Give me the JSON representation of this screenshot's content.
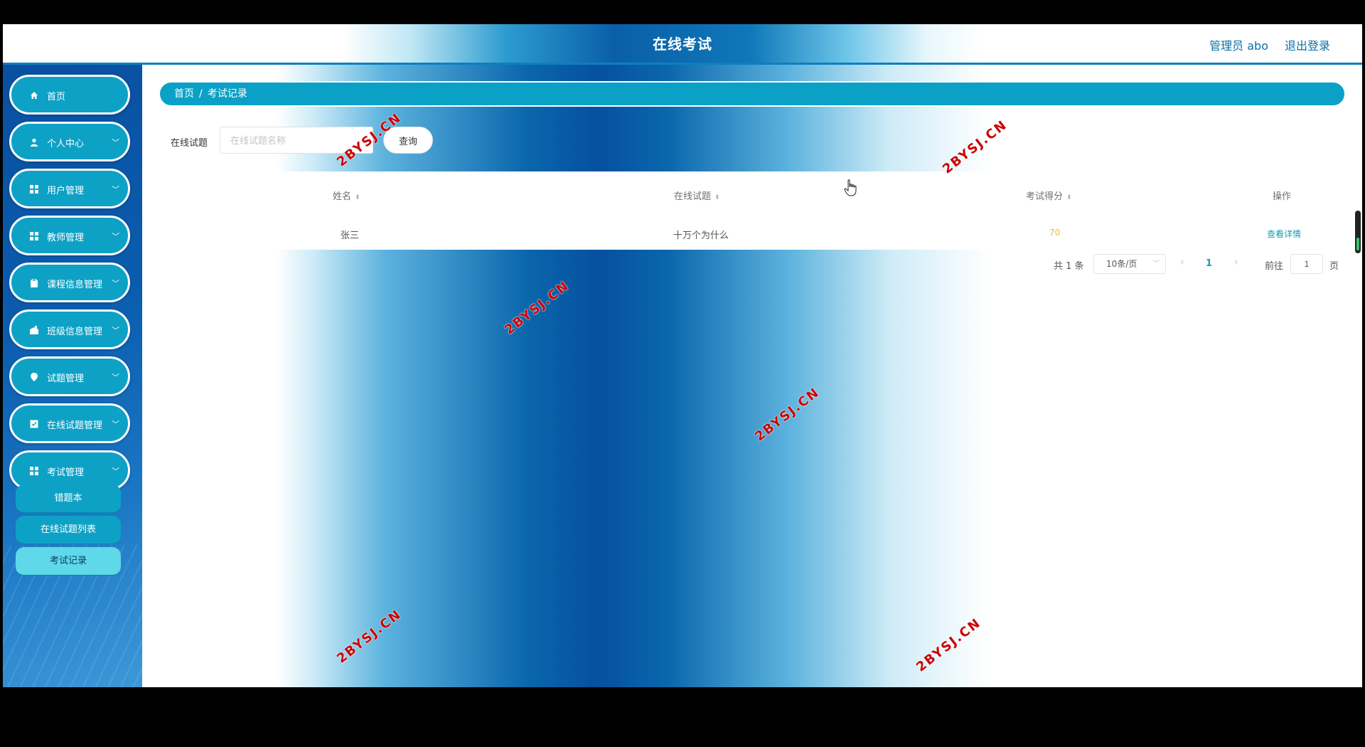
{
  "header": {
    "title": "在线考试",
    "user": "管理员 abo",
    "logout": "退出登录"
  },
  "sidebar": {
    "items": [
      {
        "label": "首页",
        "icon": "home-icon",
        "has_children": false
      },
      {
        "label": "个人中心",
        "icon": "user-icon",
        "has_children": true
      },
      {
        "label": "用户管理",
        "icon": "grid-icon",
        "has_children": true
      },
      {
        "label": "教师管理",
        "icon": "grid-icon",
        "has_children": true
      },
      {
        "label": "课程信息管理",
        "icon": "clipboard-icon",
        "has_children": true
      },
      {
        "label": "班级信息管理",
        "icon": "class-icon",
        "has_children": true
      },
      {
        "label": "试题管理",
        "icon": "pin-icon",
        "has_children": true
      },
      {
        "label": "在线试题管理",
        "icon": "doc-icon",
        "has_children": true
      },
      {
        "label": "考试管理",
        "icon": "grid-icon",
        "has_children": true,
        "expanded": true
      }
    ],
    "submenu": [
      {
        "label": "错题本"
      },
      {
        "label": "在线试题列表"
      },
      {
        "label": "考试记录",
        "active": true
      }
    ]
  },
  "breadcrumb": {
    "home": "首页",
    "current": "考试记录"
  },
  "search": {
    "label": "在线试题",
    "placeholder": "在线试题名称",
    "button": "查询"
  },
  "table": {
    "columns": [
      "姓名",
      "在线试题",
      "考试得分",
      "操作"
    ],
    "rows": [
      {
        "name": "张三",
        "exam": "十万个为什么",
        "score": "70",
        "action": "查看详情"
      }
    ]
  },
  "pagination": {
    "total_text": "共 1 条",
    "page_size": "10条/页",
    "current_page": "1",
    "goto_label": "前往",
    "goto_value": "1",
    "page_suffix": "页"
  },
  "watermark": "2BYSJ.CN",
  "colors": {
    "accent": "#0ea1c6",
    "active_sub": "#5fd8ea",
    "score": "#f0b94c",
    "link": "#0ea1b6"
  }
}
